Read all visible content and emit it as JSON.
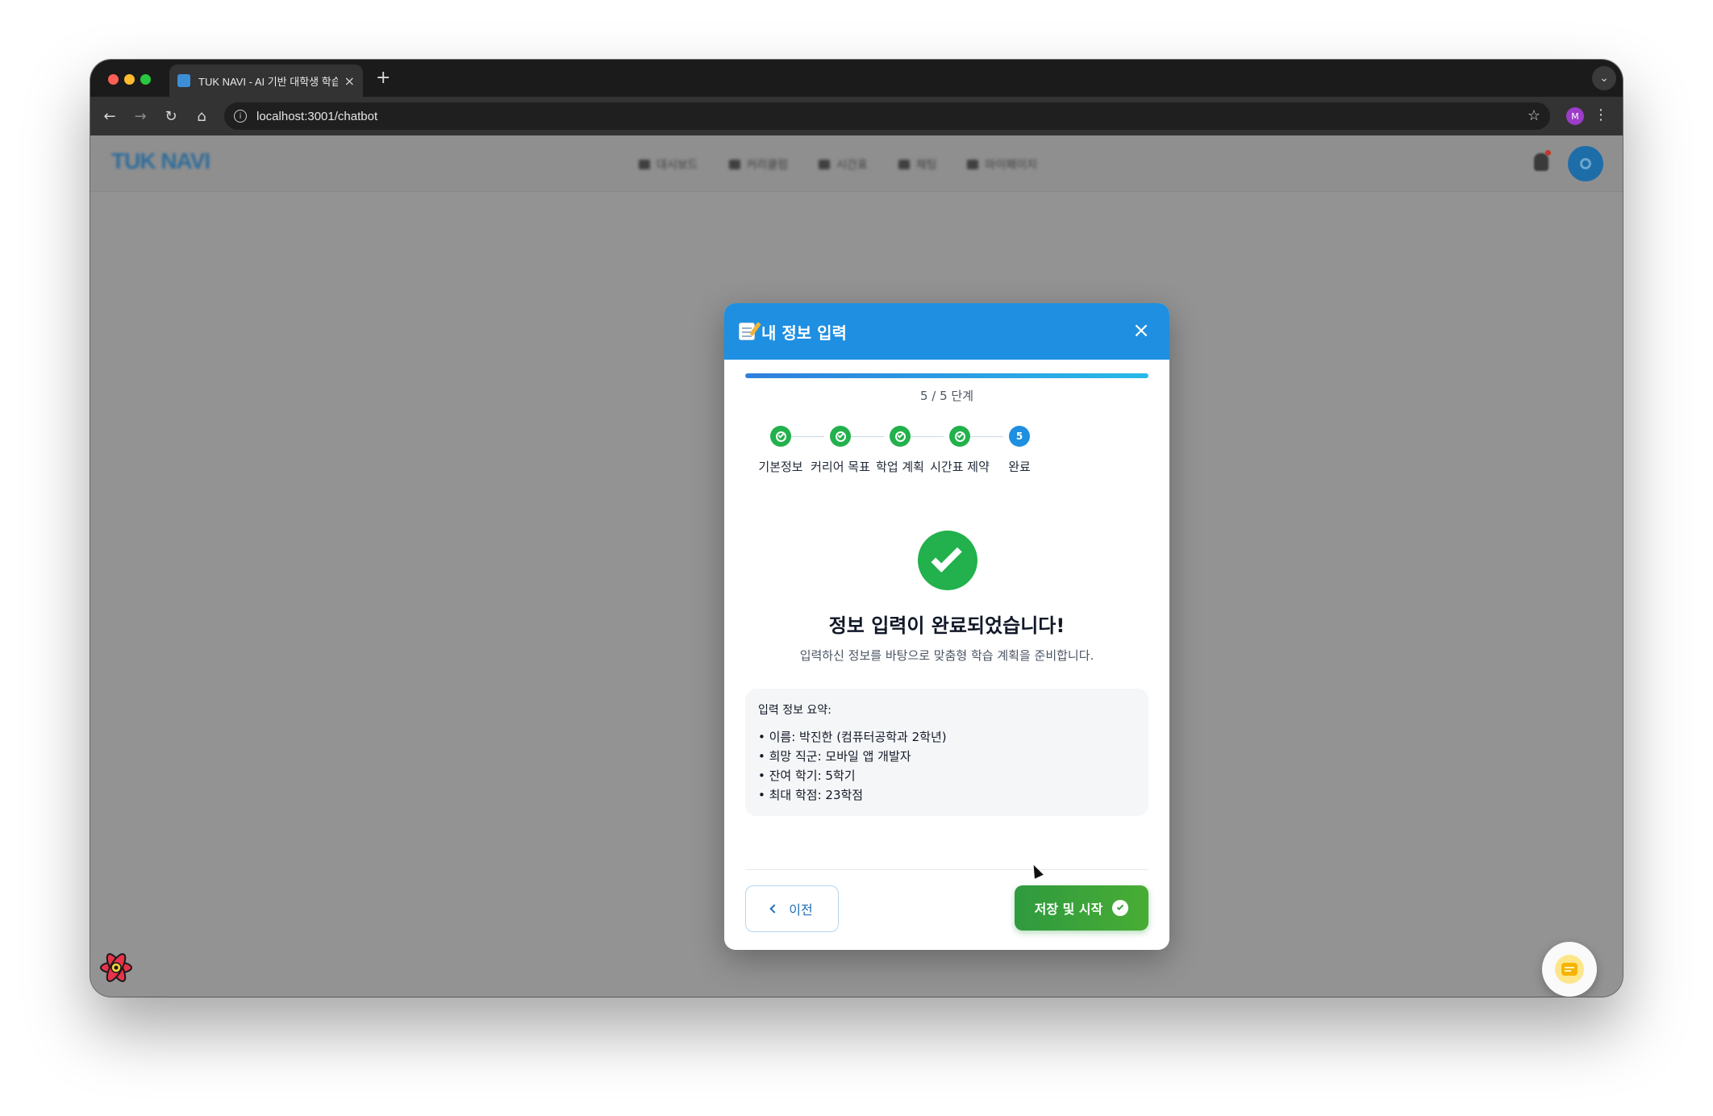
{
  "browser": {
    "tab_title": "TUK NAVI - AI 기반 대학생 학습",
    "tab_close": "×",
    "new_tab": "+",
    "url": "localhost:3001/chatbot",
    "profile_initial": "M"
  },
  "app": {
    "logo": "TUK NAVI",
    "nav": [
      "대시보드",
      "커리큘럼",
      "시간표",
      "채팅",
      "마이페이지"
    ]
  },
  "modal": {
    "title": "내 정보 입력",
    "close": "×",
    "progress_fraction": 1.0,
    "step_count": "5 / 5 단계",
    "steps": [
      {
        "label": "기본정보",
        "status": "done"
      },
      {
        "label": "커리어 목표",
        "status": "done"
      },
      {
        "label": "학업 계획",
        "status": "done"
      },
      {
        "label": "시간표 제약",
        "status": "done"
      },
      {
        "label": "완료",
        "status": "current",
        "number": "5"
      }
    ],
    "done_title": "정보 입력이 완료되었습니다!",
    "done_subtitle": "입력하신 정보를 바탕으로 맞춤형 학습 계획을 준비합니다.",
    "summary": {
      "title": "입력 정보 요약:",
      "items": [
        "• 이름: 박진한 (컴퓨터공학과 2학년)",
        "• 희망 직군: 모바일 앱 개발자",
        "• 잔여 학기: 5학기",
        "• 최대 학점: 23학점"
      ]
    },
    "prev_label": "이전",
    "save_label": "저장 및 시작"
  },
  "colors": {
    "primary": "#1e8fe1",
    "success": "#22b14c",
    "overlay": "#939393"
  }
}
